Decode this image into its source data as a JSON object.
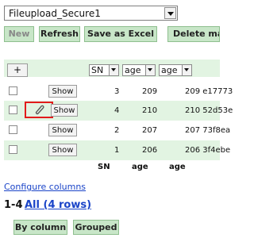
{
  "file_selector": {
    "value": "Fileupload_Secure1"
  },
  "toolbar": {
    "new_label": "New",
    "refresh_label": "Refresh",
    "save_excel_label": "Save as Excel",
    "delete_label": "Delete mark"
  },
  "table": {
    "add_label": "+",
    "header_selects": [
      "SN",
      "age",
      "age"
    ],
    "rows": [
      {
        "show_label": "Show",
        "sn": "3",
        "age": "209",
        "extra": "209 e17773"
      },
      {
        "show_label": "Show",
        "sn": "4",
        "age": "210",
        "extra": "210 52d53e"
      },
      {
        "show_label": "Show",
        "sn": "2",
        "age": "207",
        "extra": "207 73f8ea"
      },
      {
        "show_label": "Show",
        "sn": "1",
        "age": "206",
        "extra": "206 3f4ebe"
      }
    ],
    "footer": [
      "SN",
      "age",
      "age"
    ]
  },
  "configure_columns_label": "Configure columns",
  "paging": {
    "range": "1-4",
    "all_label": "All (4 rows)"
  },
  "grouping": {
    "by_column_label": "By column",
    "grouped_label": "Grouped"
  },
  "colors": {
    "accent": "#c8e6c8",
    "row_highlight": "#e2f4e2",
    "annotation": "#e21b1b",
    "link": "#1a44c8"
  }
}
